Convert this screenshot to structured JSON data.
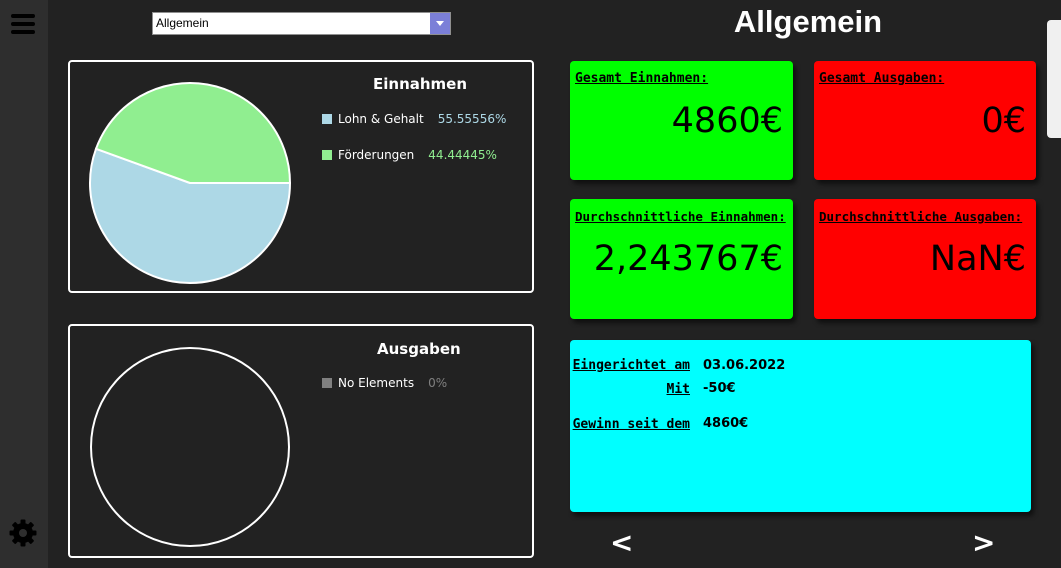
{
  "colors": {
    "background": "#222222",
    "sidebar": "#2e2e2e",
    "income_green": "#00ff00",
    "expense_red": "#ff0000",
    "info_cyan": "#00ffff",
    "pie_lohn": "#add8e6",
    "pie_foerderung": "#90ee90",
    "no_elements": "#808080"
  },
  "sidebar": {
    "menu_icon": "hamburger-icon",
    "settings_icon": "gear-icon"
  },
  "selector": {
    "value": "Allgemein"
  },
  "page": {
    "title": "Allgemein"
  },
  "income_chart": {
    "title": "Einnahmen",
    "legend": [
      {
        "name": "Lohn & Gehalt",
        "percent": "55.55556%",
        "color": "#add8e6"
      },
      {
        "name": "Förderungen",
        "percent": "44.44445%",
        "color": "#90ee90"
      }
    ]
  },
  "expense_chart": {
    "title": "Ausgaben",
    "legend": [
      {
        "name": "No Elements",
        "percent": "0%",
        "color": "#808080"
      }
    ]
  },
  "chart_data": [
    {
      "type": "pie",
      "title": "Einnahmen",
      "categories": [
        "Lohn & Gehalt",
        "Förderungen"
      ],
      "values": [
        55.55556,
        44.44445
      ]
    },
    {
      "type": "pie",
      "title": "Ausgaben",
      "categories": [
        "No Elements"
      ],
      "values": [
        0
      ]
    }
  ],
  "cards": {
    "total_income": {
      "label": "Gesamt Einnahmen:",
      "value": "4860€"
    },
    "total_expense": {
      "label": "Gesamt Ausgaben:",
      "value": "0€"
    },
    "avg_income": {
      "label": "Durchschnittliche Einnahmen:",
      "value": "2,243767€"
    },
    "avg_expense": {
      "label": "Durchschnittliche Ausgaben:",
      "value": "NaN€"
    }
  },
  "info": {
    "created_label": "Eingerichtet am",
    "created_value": "03.06.2022",
    "with_label": "Mit",
    "with_value": "-50€",
    "profit_label": "Gewinn seit dem",
    "profit_value": "4860€"
  },
  "nav": {
    "prev": "<",
    "next": ">"
  }
}
